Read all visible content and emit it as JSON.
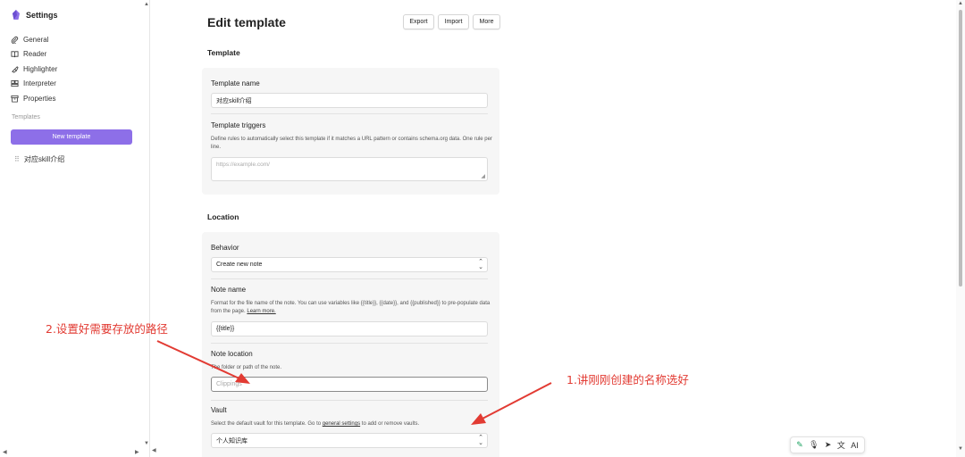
{
  "sidebar": {
    "title": "Settings",
    "items": [
      {
        "label": "General",
        "icon": "paperclip-icon"
      },
      {
        "label": "Reader",
        "icon": "book-icon"
      },
      {
        "label": "Highlighter",
        "icon": "highlighter-icon"
      },
      {
        "label": "Interpreter",
        "icon": "interpreter-icon"
      },
      {
        "label": "Properties",
        "icon": "archive-icon"
      }
    ],
    "templates_label": "Templates",
    "new_template_label": "New template",
    "template_items": [
      "对应skill介绍"
    ]
  },
  "header": {
    "title": "Edit template",
    "buttons": [
      "Export",
      "Import",
      "More"
    ]
  },
  "template_section": {
    "heading": "Template",
    "name_label": "Template name",
    "name_value": "对应skill介绍",
    "triggers_label": "Template triggers",
    "triggers_desc": "Define rules to automatically select this template if it matches a URL pattern or contains schema.org data. One rule per line.",
    "triggers_placeholder": "https://example.com/"
  },
  "location_section": {
    "heading": "Location",
    "behavior_label": "Behavior",
    "behavior_value": "Create new note",
    "note_name_label": "Note name",
    "note_name_desc": "Format for the file name of the note. You can use variables like {{title}}, {{date}}, and {{published}} to pre-populate data from the page.",
    "note_name_link": "Learn more.",
    "note_name_value": "{{title}}",
    "note_location_label": "Note location",
    "note_location_desc": "The folder or path of the note.",
    "note_location_placeholder": "Clippings",
    "vault_label": "Vault",
    "vault_desc_pre": "Select the default vault for this template. Go to",
    "vault_desc_link": "general settings",
    "vault_desc_post": "to add or remove vaults.",
    "vault_value": "个人知识库"
  },
  "annotations": {
    "left": "2.设置好需要存放的路径",
    "right": "1.讲刚刚创建的名称选好",
    "color": "#e23b33"
  },
  "toolbar": {
    "icons": [
      "sparkle-pen-icon",
      "microphone-icon",
      "send-icon",
      "translate-icon",
      "ai-icon"
    ],
    "ai_label": "AI"
  },
  "colors": {
    "accent": "#8d6fe8"
  }
}
